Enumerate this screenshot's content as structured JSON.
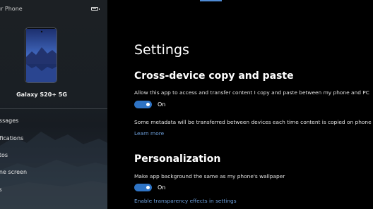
{
  "sidebar": {
    "title": "ur Phone",
    "battery_level": 0.8,
    "device_name": "Galaxy S20+ 5G",
    "items": [
      {
        "label": "essages"
      },
      {
        "label": "tifications"
      },
      {
        "label": "otos"
      },
      {
        "label": "one screen"
      },
      {
        "label": "lls"
      }
    ]
  },
  "settings": {
    "title": "Settings",
    "copy_paste": {
      "title": "Cross-device copy and paste",
      "description": "Allow this app to access and transfer content I copy and paste between my phone and PC",
      "toggle_state": "On",
      "metadata_note": "Some metadata will be transferred between devices each time content is copied on phone",
      "learn_more": "Learn more"
    },
    "personalization": {
      "title": "Personalization",
      "description": "Make app background the same as my phone's wallpaper",
      "toggle_state": "On",
      "transparency_link": "Enable transparency effects in settings"
    }
  },
  "colors": {
    "accent": "#2e73c4",
    "link": "#6ea0db",
    "sidebar_bg": "#1c2024",
    "main_bg": "#000000"
  }
}
